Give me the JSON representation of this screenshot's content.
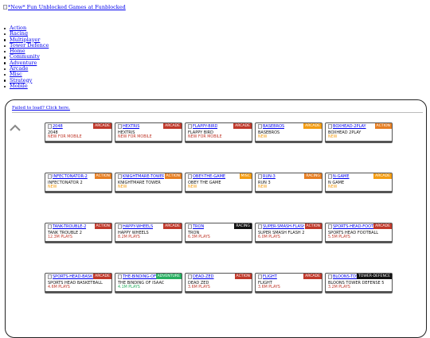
{
  "logo": {
    "alt": "*New* Fun Unblocked Games at Funblocked"
  },
  "nav": [
    {
      "label": "Action"
    },
    {
      "label": "Racing"
    },
    {
      "label": "Multiplayer"
    },
    {
      "label": "Tower Defence"
    },
    {
      "label": "Home"
    },
    {
      "label": "Community"
    },
    {
      "label": "Adventure"
    },
    {
      "label": "Arcade"
    },
    {
      "label": "Misc"
    },
    {
      "label": "Strategy"
    },
    {
      "label": "Mobile"
    }
  ],
  "panel": {
    "fail_text": "Failed to load? Click here."
  },
  "colors": {
    "arcade": "#c0392b",
    "action": "#e67e22",
    "racing": "#111111",
    "adventure": "#27ae60",
    "tower-defence": "#111111",
    "misc": "#f39c12",
    "new": "#f39c12",
    "plays": "#c0392b"
  },
  "games": [
    {
      "slug": "2048",
      "title": "2048",
      "cat": "ARCADE",
      "catkey": "arcade",
      "sub": "NEW FOR MOBILE",
      "subkey": "plays"
    },
    {
      "slug": "HEXTRIS",
      "title": "HEXTRIS",
      "cat": "ARCADE",
      "catkey": "arcade",
      "sub": "NEW FOR MOBILE",
      "subkey": "plays"
    },
    {
      "slug": "FLAPPY-BIRD",
      "title": "FLAPPY BIRD",
      "cat": "ARCADE",
      "catkey": "arcade",
      "sub": "NEW FOR MOBILE",
      "subkey": "plays"
    },
    {
      "slug": "BASEBROS",
      "title": "BASEBROS",
      "cat": "ARCADE",
      "catkey": "misc",
      "sub": "NEW",
      "subkey": "new"
    },
    {
      "slug": "BOXHEAD-2PLAY",
      "title": "BOXHEAD 2PLAY",
      "cat": "ACTION",
      "catkey": "action",
      "sub": "NEW",
      "subkey": "new"
    },
    {
      "slug": "INFECTONATOR-2",
      "title": "INFECTONATOR 2",
      "cat": "ACTION",
      "catkey": "action",
      "sub": "NEW",
      "subkey": "new"
    },
    {
      "slug": "KNIGHTMARE-TOWER",
      "title": "KNIGHTMARE TOWER",
      "cat": "ACTION",
      "catkey": "action",
      "sub": "NEW",
      "subkey": "new"
    },
    {
      "slug": "OBEY-THE-GAME",
      "title": "OBEY THE GAME",
      "cat": "MISC",
      "catkey": "misc",
      "sub": "NEW",
      "subkey": "new"
    },
    {
      "slug": "RUN-3",
      "title": "RUN 3",
      "cat": "RACING",
      "catkey": "action",
      "sub": "NEW",
      "subkey": "new"
    },
    {
      "slug": "N-GAME",
      "title": "N GAME",
      "cat": "ARCADE",
      "catkey": "misc",
      "sub": "NEW",
      "subkey": "new"
    },
    {
      "slug": "TANK-TROUBLE-2",
      "title": "TANK TROUBLE 2",
      "cat": "ACTION",
      "catkey": "arcade",
      "sub": "12.3M PLAYS",
      "subkey": "plays"
    },
    {
      "slug": "HAPPY-WHEELS",
      "title": "HAPPY WHEELS",
      "cat": "ARCADE",
      "catkey": "arcade",
      "sub": "8.2M PLAYS",
      "subkey": "plays"
    },
    {
      "slug": "TRON",
      "title": "TRON",
      "cat": "RACING",
      "catkey": "racing",
      "sub": "6.3M PLAYS",
      "subkey": "plays"
    },
    {
      "slug": "SUPER-SMASH-FLASH-2",
      "title": "SUPER SMASH FLASH 2",
      "cat": "ACTION",
      "catkey": "arcade",
      "sub": "6.0M PLAYS",
      "subkey": "plays"
    },
    {
      "slug": "SPORTS-HEAD-FOOTBALL",
      "title": "SPORTS HEAD FOOTBALL",
      "cat": "ARCADE",
      "catkey": "arcade",
      "sub": "5.5M PLAYS",
      "subkey": "plays"
    },
    {
      "slug": "SPORTS-HEAD-BASKETBALL",
      "title": "SPORTS HEAD BASKETBALL",
      "cat": "ARCADE",
      "catkey": "arcade",
      "sub": "4.6M PLAYS",
      "subkey": "plays"
    },
    {
      "slug": "THE-BINDING-OF-ISAAC",
      "title": "THE BINDING OF ISAAC",
      "cat": "ADVENTURE",
      "catkey": "adventure",
      "sub": "4.1M PLAYS",
      "subkey": "adventure"
    },
    {
      "slug": "DEAD-ZED",
      "title": "DEAD ZED",
      "cat": "ACTION",
      "catkey": "arcade",
      "sub": "3.6M PLAYS",
      "subkey": "plays"
    },
    {
      "slug": "FLIGHT",
      "title": "FLIGHT",
      "cat": "ARCADE",
      "catkey": "arcade",
      "sub": "3.6M PLAYS",
      "subkey": "plays"
    },
    {
      "slug": "BLOONS-TD5",
      "title": "BLOONS TOWER DEFENSE 5",
      "cat": "TOWER-DEFENCE",
      "catkey": "tower-defence",
      "sub": "3.2M PLAYS",
      "subkey": "plays"
    }
  ]
}
